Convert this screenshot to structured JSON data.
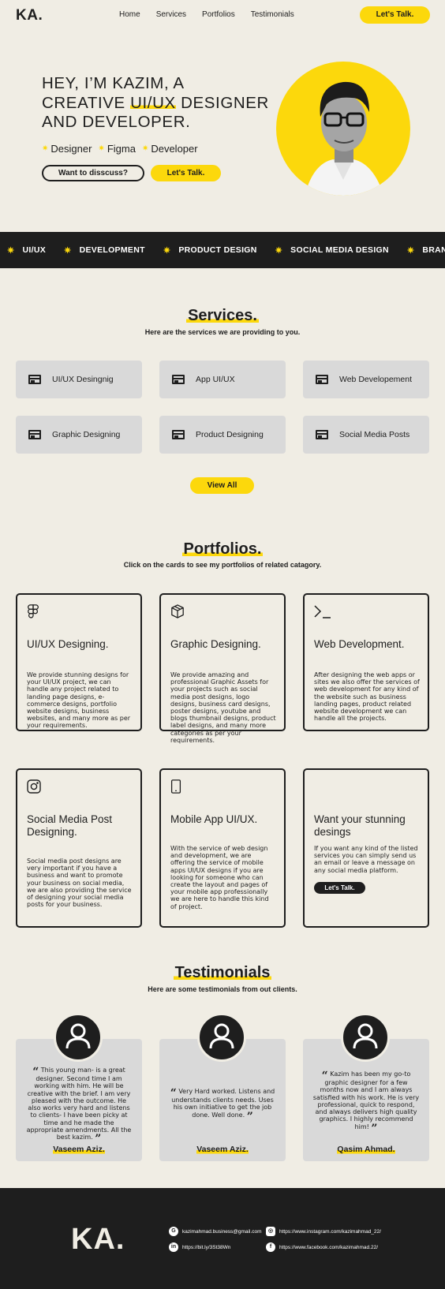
{
  "nav": {
    "logo": "KA.",
    "links": [
      "Home",
      "Services",
      "Portfolios",
      "Testimonials"
    ],
    "cta": "Let's Talk."
  },
  "hero": {
    "title_line1": "HEY, I’M KAZIM, A",
    "title_line2_pre": "CREATIVE ",
    "title_line2_hl": "UI/UX",
    "title_line2_post": " DESIGNER",
    "title_line3": "AND DEVELOPER.",
    "skills": [
      "Designer",
      "Figma",
      "Developer"
    ],
    "btn_discuss": "Want to disscuss?",
    "btn_talk": "Let's Talk."
  },
  "ticker": [
    "UI/UX",
    "DEVELOPMENT",
    "PRODUCT DESIGN",
    "SOCIAL MEDIA DESIGN",
    "BRANDING"
  ],
  "services": {
    "title": "Services.",
    "subtitle": "Here are the services we are providing to you.",
    "items": [
      "UI/UX Desingnig",
      "App UI/UX",
      "Web Developement",
      "Graphic Designing",
      "Product Designing",
      "Social Media Posts"
    ],
    "view_all": "View All"
  },
  "portfolios": {
    "title": "Portfolios.",
    "subtitle": "Click on the cards to see my portfolios of related catagory.",
    "cards": [
      {
        "icon": "figma-icon",
        "title": "UI/UX Designing.",
        "desc": "We provide stunning designs for your UI/UX project, we can handle any project related to landing page designs, e-commerce designs, portfolio website designs, business websites, and many more as per your requirements."
      },
      {
        "icon": "box-icon",
        "title": "Graphic Designing.",
        "desc": "We provide amazing and professional Graphic Assets for your projects such as social media post designs, logo designs, business card designs, poster designs, youtube and blogs thumbnail designs, product label designs, and many more categories as per your requirements."
      },
      {
        "icon": "terminal-icon",
        "title": "Web Development.",
        "desc": "After designing the web apps or sites we also offer the services of web development for any kind of the website such as business landing pages, product related website development we can handle all the projects."
      },
      {
        "icon": "instagram-icon",
        "title": "Social Media Post Designing.",
        "desc": "Social media post designs are very important if you have a business and want to promote your business on social media, we are also providing the service of designing your social media posts for your business."
      },
      {
        "icon": "tablet-icon",
        "title": "Mobile App UI/UX.",
        "desc": "With the service of web design and development, we are offering the service of mobile apps UI/UX designs if you are looking for someone who can create the layout and pages of your mobile app professionally we are here to handle this kind of project."
      },
      {
        "icon": "",
        "title": "Want your stunning desings",
        "desc": "If you want any kind of the listed services you can simply send us an email or leave a message on any social media platform.",
        "button": "Let's Talk."
      }
    ]
  },
  "testimonials": {
    "title": "Testimonials",
    "subtitle": "Here are some testimonials from out clients.",
    "items": [
      {
        "quote": "This young man- is a great designer. Second time I am working with him. He will be creative with the brief. I am very pleased with the outcome. He also works very hard and listens to clients- I have been picky at time and he made the appropriate amendments. All the best kazim.",
        "name": "Vaseem Aziz."
      },
      {
        "quote": "Very Hard worked. Listens and understands clients needs. Uses his own initiative to get the job done. Well done.",
        "name": "Vaseem Aziz."
      },
      {
        "quote": "Kazim has been my go-to graphic designer for a few months now and I am always satisfied with his work. He is very professional, quick to respond, and always delivers high quality graphics. I highly recommend him!",
        "name": "Qasim Ahmad."
      }
    ]
  },
  "footer": {
    "logo": "KA.",
    "email": "kazimahmad.business@gmail.com",
    "linkedin": "https://bit.ly/3St38Wn",
    "instagram": "https://www.instagram.com/kazimahmad_22/",
    "facebook": "https://www.facebook.com/kazimahmad.22/"
  },
  "colors": {
    "accent": "#fcd80c",
    "dark": "#1e1e1e",
    "bg": "#f0ede4",
    "card": "#d9d9d9"
  }
}
